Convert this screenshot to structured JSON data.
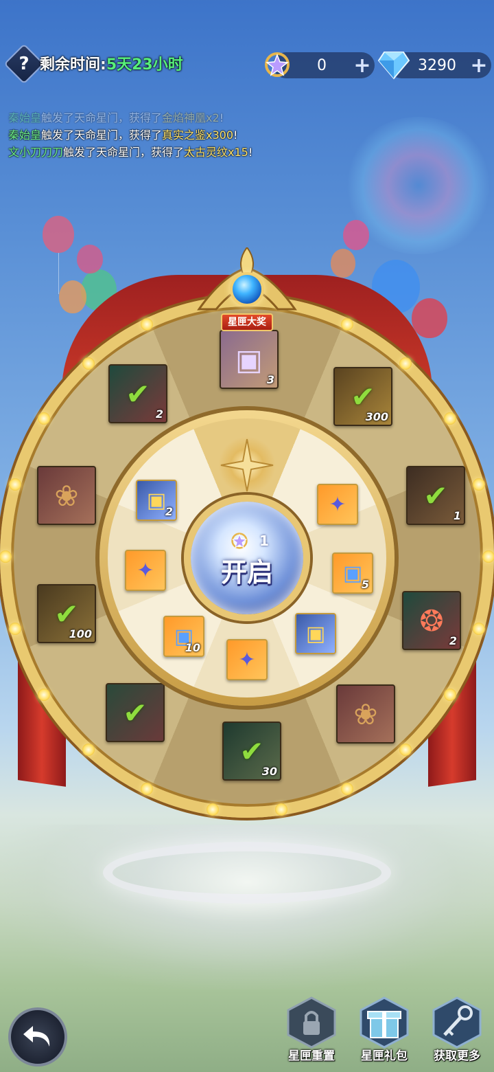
{
  "header": {
    "help_icon": "question-mark",
    "time_label": "剩余时间:",
    "time_value": "5天23小时"
  },
  "currencies": [
    {
      "icon": "star-key-icon",
      "value": "0",
      "plus": "+"
    },
    {
      "icon": "diamond-icon",
      "value": "3290",
      "plus": "+"
    }
  ],
  "broadcast": [
    {
      "name": "秦始皇",
      "mid": "触发了天命星门，获得了",
      "item": "金焰神凰x2",
      "end": "!"
    },
    {
      "name": "秦始皇",
      "mid": "触发了天命星门，获得了",
      "item": "真实之鉴x300",
      "end": "!"
    },
    {
      "name": "文小刀刀刀",
      "mid": "触发了天命星门，获得了",
      "item": "太古灵纹x15",
      "end": "!"
    }
  ],
  "wheel": {
    "grand_prize_tag": "星匣大奖",
    "outer_items": [
      {
        "qty": "3"
      },
      {
        "qty": "300"
      },
      {
        "qty": "1"
      },
      {
        "qty": "2"
      },
      {
        "qty": ""
      },
      {
        "qty": "30"
      },
      {
        "qty": ""
      },
      {
        "qty": "100"
      },
      {
        "qty": ""
      },
      {
        "qty": "2"
      }
    ],
    "inner_items": [
      {
        "qty": "2"
      },
      {
        "qty": ""
      },
      {
        "qty": "5"
      },
      {
        "qty": ""
      },
      {
        "qty": ""
      },
      {
        "qty": "10"
      },
      {
        "qty": ""
      }
    ],
    "center": {
      "cost": "1",
      "label": "开启"
    }
  },
  "bottom_bar": {
    "back_icon": "back-arrow-icon",
    "buttons": [
      {
        "label": "星匣重置",
        "icon": "lock-icon"
      },
      {
        "label": "星匣礼包",
        "icon": "gift-box-icon"
      },
      {
        "label": "获取更多",
        "icon": "key-icon"
      }
    ]
  },
  "colors": {
    "player_name": "#6df087",
    "item_name": "#ffe36a",
    "time_value": "#57f07a"
  }
}
